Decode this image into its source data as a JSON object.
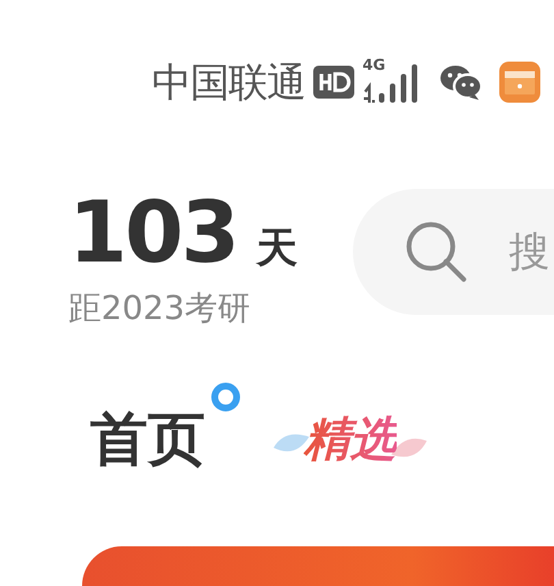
{
  "status_bar": {
    "carrier": "中国联通",
    "network": "4G"
  },
  "countdown": {
    "days": "103",
    "unit": "天",
    "caption": "距2023考研"
  },
  "search": {
    "placeholder": "搜"
  },
  "tabs": [
    {
      "label": "首页",
      "kind": "plain",
      "selected": true
    },
    {
      "label": "精选",
      "kind": "featured",
      "selected": false
    }
  ]
}
